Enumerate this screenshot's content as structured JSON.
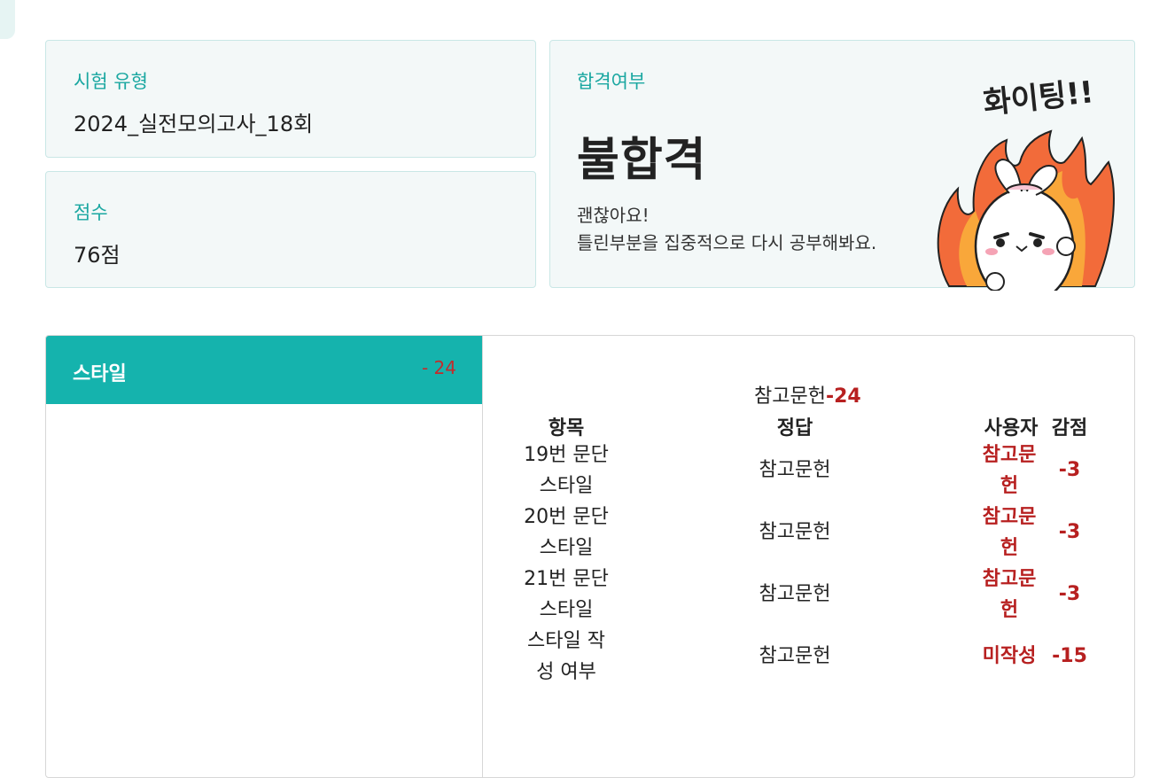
{
  "exam": {
    "label": "시험 유형",
    "value": "2024_실전모의고사_18회"
  },
  "score": {
    "label": "점수",
    "value": "76점"
  },
  "result": {
    "label": "합격여부",
    "status": "불합격",
    "message_line1": "괜찮아요!",
    "message_line2": "틀린부분을 집중적으로 다시 공부해봐요.",
    "mascot_text": "화이팅!!"
  },
  "category": {
    "title": "스타일",
    "deduction": "- 24"
  },
  "table": {
    "caption_text": "참고문헌",
    "caption_total": "-24",
    "headers": {
      "item": "항목",
      "answer": "정답",
      "user": "사용자",
      "deduct": "감점"
    },
    "rows": [
      {
        "item_l1": "19번 문단",
        "item_l2": "스타일",
        "answer": "참고문헌",
        "user_l1": "참고문",
        "user_l2": "헌",
        "deduct": "-3"
      },
      {
        "item_l1": "20번 문단",
        "item_l2": "스타일",
        "answer": "참고문헌",
        "user_l1": "참고문",
        "user_l2": "헌",
        "deduct": "-3"
      },
      {
        "item_l1": "21번 문단",
        "item_l2": "스타일",
        "answer": "참고문헌",
        "user_l1": "참고문",
        "user_l2": "헌",
        "deduct": "-3"
      },
      {
        "item_l1": "스타일 작",
        "item_l2": "성 여부",
        "answer": "참고문헌",
        "user_l1": "미작성",
        "user_l2": "",
        "deduct": "-15"
      }
    ]
  },
  "colors": {
    "accent": "#15b3ad",
    "label": "#1aa7a1",
    "negative": "#b72020"
  }
}
